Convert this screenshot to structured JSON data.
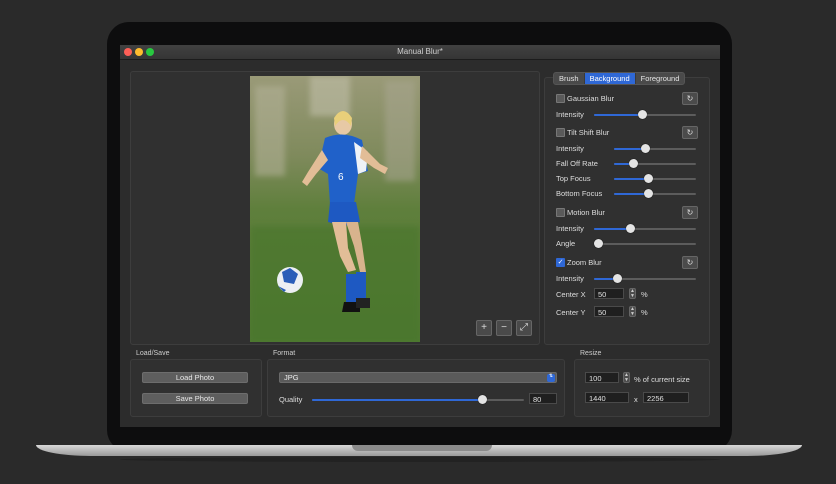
{
  "window": {
    "title": "Manual Blur*",
    "accent": "#2f68d6"
  },
  "tabs": [
    {
      "label": "Brush"
    },
    {
      "label": "Background",
      "active": true
    },
    {
      "label": "Foreground"
    }
  ],
  "controls": {
    "gaussian": {
      "label": "Gaussian Blur",
      "checked": false,
      "intensity_label": "Intensity",
      "intensity": 0.47
    },
    "tilt": {
      "label": "Tilt Shift Blur",
      "checked": false,
      "sliders": [
        {
          "label": "Intensity",
          "value": 0.38
        },
        {
          "label": "Fall Off Rate",
          "value": 0.23
        },
        {
          "label": "Top Focus",
          "value": 0.41
        },
        {
          "label": "Bottom Focus",
          "value": 0.41
        }
      ]
    },
    "motion": {
      "label": "Motion Blur",
      "checked": false,
      "sliders": [
        {
          "label": "Intensity",
          "value": 0.35
        },
        {
          "label": "Angle",
          "value": 0.04
        }
      ]
    },
    "zoom": {
      "label": "Zoom Blur",
      "checked": true,
      "check_glyph": "✓",
      "intensity_label": "Intensity",
      "intensity": 0.23,
      "center_x_label": "Center X",
      "center_x": "50",
      "center_y_label": "Center Y",
      "center_y": "50",
      "pct": "%"
    }
  },
  "canvas_controls": {
    "zoom_in": "+",
    "zoom_out": "−",
    "fit": "⤢"
  },
  "load_save": {
    "title": "Load/Save",
    "load": "Load Photo",
    "save": "Save Photo"
  },
  "format": {
    "title": "Format",
    "selected": "JPG",
    "quality_label": "Quality",
    "quality_value": "80",
    "quality": 0.8
  },
  "resize": {
    "title": "Resize",
    "percent": "100",
    "percent_label": "% of current size",
    "width": "1440",
    "x": "x",
    "height": "2256"
  },
  "icons": {
    "reset": "reset-icon",
    "stepper": "stepper-icon",
    "select_arrows": "chevron-updown-icon"
  },
  "glyphs": {
    "reset": "↻",
    "step_up": "▲",
    "step_down": "▼",
    "select": "⇅"
  }
}
